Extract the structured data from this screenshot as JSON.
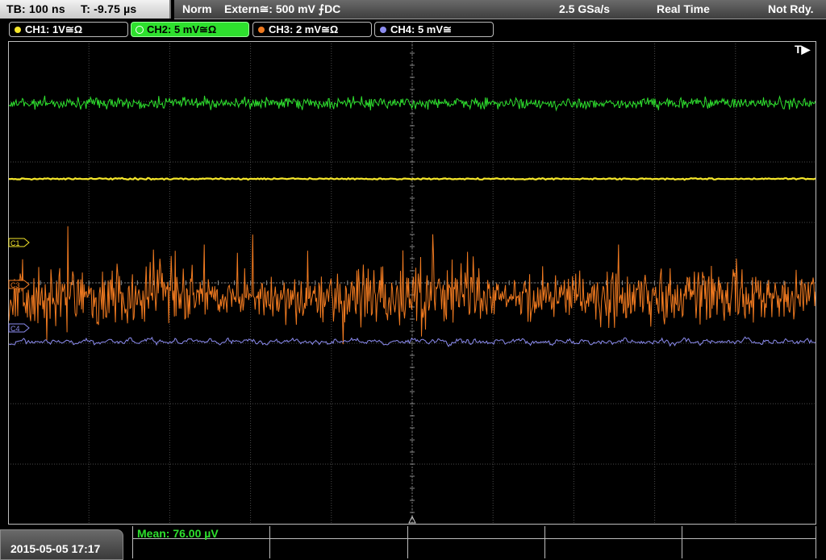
{
  "header": {
    "timebase": "TB: 100 ns",
    "trigger_time": "T: -9.75 µs",
    "mode": "Norm",
    "trigger_source": "Extern≅: 500 mV ⨍DC",
    "sample_rate": "2.5 GSa/s",
    "acq_mode": "Real Time",
    "status": "Not Rdy."
  },
  "channels": [
    {
      "id": "ch1",
      "label": "CH1: 1V≅Ω",
      "color": "#f5e62a",
      "active": false
    },
    {
      "id": "ch2",
      "label": "CH2: 5 mV≅Ω",
      "color": "#2ee02e",
      "active": true
    },
    {
      "id": "ch3",
      "label": "CH3: 2 mV≅Ω",
      "color": "#f07a20",
      "active": false
    },
    {
      "id": "ch4",
      "label": "CH4: 5 mV≅",
      "color": "#8c8cf0",
      "active": false
    }
  ],
  "markers": {
    "c1": "C1",
    "c3": "C3",
    "c4": "C4",
    "trigger_position": "T▶"
  },
  "footer": {
    "datetime": "2015-05-05 17:17",
    "measurement": "Mean: 76.00 µV"
  },
  "colors": {
    "ch1": "#f5e62a",
    "ch2": "#2ee02e",
    "ch3": "#f07a20",
    "ch4": "#8c8cf0",
    "grid": "#4a4a4a"
  }
}
